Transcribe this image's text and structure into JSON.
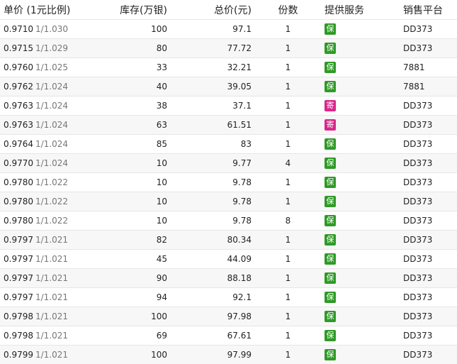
{
  "header": {
    "price": "单价 (1元比例)",
    "stock": "库存(万银)",
    "total": "总价(元)",
    "qty": "份数",
    "service": "提供服务",
    "platform": "销售平台"
  },
  "colors": {
    "service_green": "#2f9a27",
    "service_pink": "#d9278b"
  },
  "rows": [
    {
      "price": "0.9710",
      "ratio": "1/1.030",
      "stock": "100",
      "total": "97.1",
      "qty": "1",
      "service": "保",
      "service_color": "green",
      "platform": "DD373"
    },
    {
      "price": "0.9715",
      "ratio": "1/1.029",
      "stock": "80",
      "total": "77.72",
      "qty": "1",
      "service": "保",
      "service_color": "green",
      "platform": "DD373"
    },
    {
      "price": "0.9760",
      "ratio": "1/1.025",
      "stock": "33",
      "total": "32.21",
      "qty": "1",
      "service": "保",
      "service_color": "green",
      "platform": "7881"
    },
    {
      "price": "0.9762",
      "ratio": "1/1.024",
      "stock": "40",
      "total": "39.05",
      "qty": "1",
      "service": "保",
      "service_color": "green",
      "platform": "7881"
    },
    {
      "price": "0.9763",
      "ratio": "1/1.024",
      "stock": "38",
      "total": "37.1",
      "qty": "1",
      "service": "寄",
      "service_color": "pink",
      "platform": "DD373"
    },
    {
      "price": "0.9763",
      "ratio": "1/1.024",
      "stock": "63",
      "total": "61.51",
      "qty": "1",
      "service": "寄",
      "service_color": "pink",
      "platform": "DD373"
    },
    {
      "price": "0.9764",
      "ratio": "1/1.024",
      "stock": "85",
      "total": "83",
      "qty": "1",
      "service": "保",
      "service_color": "green",
      "platform": "DD373"
    },
    {
      "price": "0.9770",
      "ratio": "1/1.024",
      "stock": "10",
      "total": "9.77",
      "qty": "4",
      "service": "保",
      "service_color": "green",
      "platform": "DD373"
    },
    {
      "price": "0.9780",
      "ratio": "1/1.022",
      "stock": "10",
      "total": "9.78",
      "qty": "1",
      "service": "保",
      "service_color": "green",
      "platform": "DD373"
    },
    {
      "price": "0.9780",
      "ratio": "1/1.022",
      "stock": "10",
      "total": "9.78",
      "qty": "1",
      "service": "保",
      "service_color": "green",
      "platform": "DD373"
    },
    {
      "price": "0.9780",
      "ratio": "1/1.022",
      "stock": "10",
      "total": "9.78",
      "qty": "8",
      "service": "保",
      "service_color": "green",
      "platform": "DD373"
    },
    {
      "price": "0.9797",
      "ratio": "1/1.021",
      "stock": "82",
      "total": "80.34",
      "qty": "1",
      "service": "保",
      "service_color": "green",
      "platform": "DD373"
    },
    {
      "price": "0.9797",
      "ratio": "1/1.021",
      "stock": "45",
      "total": "44.09",
      "qty": "1",
      "service": "保",
      "service_color": "green",
      "platform": "DD373"
    },
    {
      "price": "0.9797",
      "ratio": "1/1.021",
      "stock": "90",
      "total": "88.18",
      "qty": "1",
      "service": "保",
      "service_color": "green",
      "platform": "DD373"
    },
    {
      "price": "0.9797",
      "ratio": "1/1.021",
      "stock": "94",
      "total": "92.1",
      "qty": "1",
      "service": "保",
      "service_color": "green",
      "platform": "DD373"
    },
    {
      "price": "0.9798",
      "ratio": "1/1.021",
      "stock": "100",
      "total": "97.98",
      "qty": "1",
      "service": "保",
      "service_color": "green",
      "platform": "DD373"
    },
    {
      "price": "0.9798",
      "ratio": "1/1.021",
      "stock": "69",
      "total": "67.61",
      "qty": "1",
      "service": "保",
      "service_color": "green",
      "platform": "DD373"
    },
    {
      "price": "0.9799",
      "ratio": "1/1.021",
      "stock": "100",
      "total": "97.99",
      "qty": "1",
      "service": "保",
      "service_color": "green",
      "platform": "DD373"
    }
  ]
}
